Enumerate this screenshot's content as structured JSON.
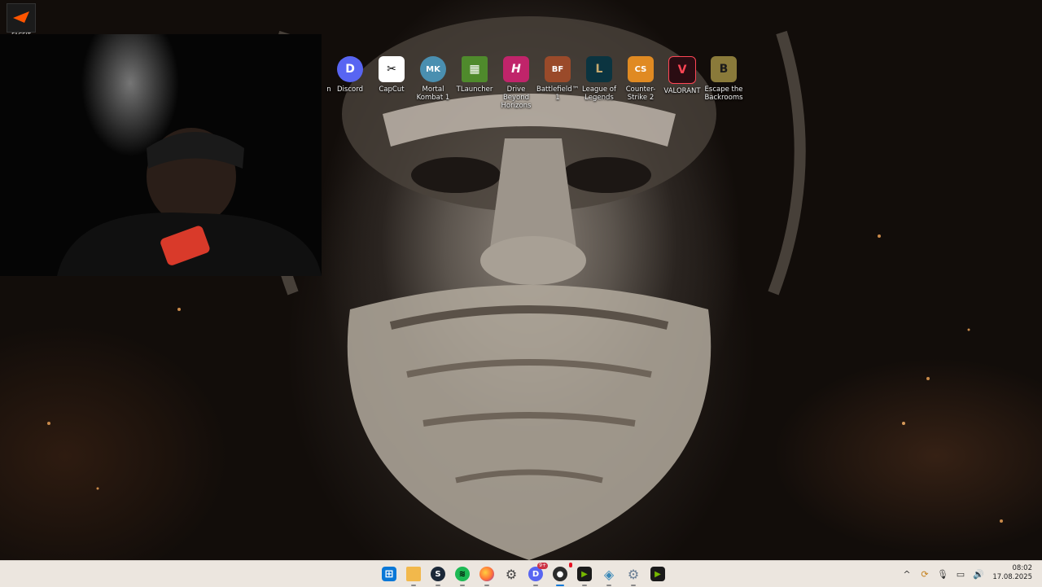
{
  "corner_app": {
    "icon": "faceit-icon",
    "label": "FACEIT"
  },
  "desktop_icons": [
    {
      "label": "n",
      "icon": "app-icon",
      "color": "#444444",
      "glyph": ""
    },
    {
      "label": "Discord",
      "icon": "discord-icon",
      "color": "#5865F2",
      "glyph": "D"
    },
    {
      "label": "CapCut",
      "icon": "capcut-icon",
      "color": "#ffffff",
      "glyph": "✂"
    },
    {
      "label": "Mortal Kombat 1",
      "icon": "mortal-kombat-icon",
      "color": "#4a8fb0",
      "glyph": "MK"
    },
    {
      "label": "TLauncher",
      "icon": "tlauncher-icon",
      "color": "#4f8a2c",
      "glyph": "▦"
    },
    {
      "label": "Drive Beyond Horizons",
      "icon": "drive-beyond-horizons-icon",
      "color": "#c0246a",
      "glyph": "H"
    },
    {
      "label": "Battlefield™ 1",
      "icon": "battlefield-icon",
      "color": "#9a4a2a",
      "glyph": "BF"
    },
    {
      "label": "League of Legends",
      "icon": "league-of-legends-icon",
      "color": "#0b3440",
      "glyph": "L"
    },
    {
      "label": "Counter-Strike 2",
      "icon": "counter-strike-icon",
      "color": "#e08a22",
      "glyph": "CS"
    },
    {
      "label": "VALORANT",
      "icon": "valorant-icon",
      "color": "#2a0c12",
      "glyph": "V"
    },
    {
      "label": "Escape the Backrooms",
      "icon": "escape-backrooms-icon",
      "color": "#8a7a3a",
      "glyph": "B"
    }
  ],
  "taskbar": {
    "apps": [
      {
        "name": "start",
        "icon": "windows-start-icon",
        "color": "#0a78d7",
        "glyph": "⊞",
        "running": false,
        "badge": ""
      },
      {
        "name": "file-explorer",
        "icon": "folder-icon",
        "color": "#f2b84b",
        "glyph": "",
        "running": true,
        "badge": ""
      },
      {
        "name": "steam",
        "icon": "steam-icon",
        "color": "#1b2838",
        "glyph": "S",
        "running": true,
        "badge": ""
      },
      {
        "name": "spotify",
        "icon": "spotify-icon",
        "color": "#1db954",
        "glyph": "≋",
        "running": true,
        "badge": ""
      },
      {
        "name": "firefox",
        "icon": "firefox-icon",
        "color": "#ff7139",
        "glyph": "",
        "running": true,
        "badge": ""
      },
      {
        "name": "settings",
        "icon": "gear-icon",
        "color": "#5a5a5a",
        "glyph": "⚙",
        "running": false,
        "badge": ""
      },
      {
        "name": "discord",
        "icon": "discord-icon",
        "color": "#5865F2",
        "glyph": "D",
        "running": true,
        "badge": "9+"
      },
      {
        "name": "obs",
        "icon": "obs-icon",
        "color": "#2b2b2b",
        "glyph": "●",
        "running": true,
        "badge": ""
      },
      {
        "name": "nvidia",
        "icon": "nvidia-icon",
        "color": "#1a1a1a",
        "glyph": "▶",
        "running": true,
        "badge": ""
      },
      {
        "name": "network-app",
        "icon": "network-app-icon",
        "color": "#3b89b8",
        "glyph": "◈",
        "running": true,
        "badge": ""
      },
      {
        "name": "settings-2",
        "icon": "gear-icon",
        "color": "#6b7f95",
        "glyph": "⚙",
        "running": true,
        "badge": ""
      },
      {
        "name": "nvidia-2",
        "icon": "nvidia-icon",
        "color": "#1a1a1a",
        "glyph": "▶",
        "running": false,
        "badge": ""
      }
    ],
    "tray": [
      {
        "icon": "chevron-up-icon",
        "glyph": "^"
      },
      {
        "icon": "sync-icon",
        "glyph": "⟳"
      },
      {
        "icon": "microphone-icon",
        "glyph": "🎙"
      },
      {
        "icon": "display-icon",
        "glyph": "▭"
      },
      {
        "icon": "volume-icon",
        "glyph": "🔊"
      }
    ],
    "time": "08:02",
    "date": "17.08.2025"
  }
}
